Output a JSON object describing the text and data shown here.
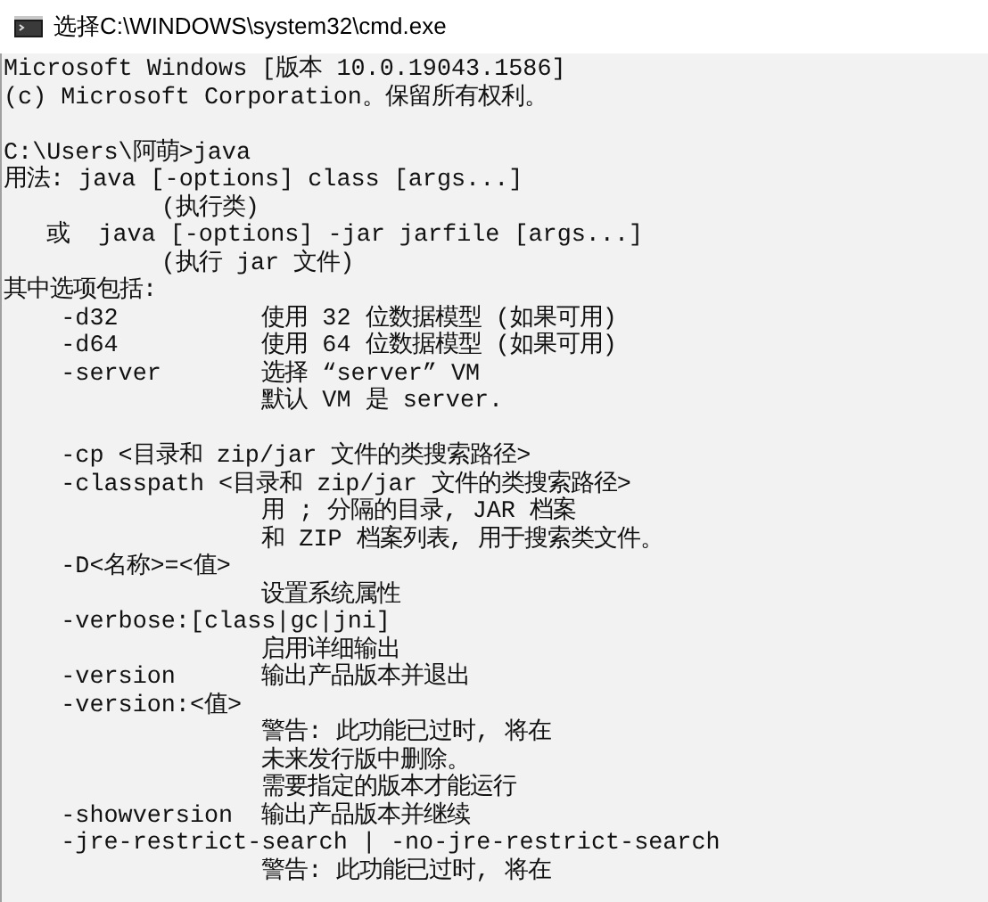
{
  "window": {
    "title": "选择C:\\WINDOWS\\system32\\cmd.exe"
  },
  "console": {
    "blocks": [
      [
        "Microsoft Windows [版本 10.0.19043.1586]",
        "(c) Microsoft Corporation。保留所有权利。"
      ],
      [
        "C:\\Users\\阿萌>java",
        "用法: java [-options] class [args...]",
        "           (执行类)",
        "   或  java [-options] -jar jarfile [args...]",
        "           (执行 jar 文件)",
        "其中选项包括:",
        "    -d32          使用 32 位数据模型 (如果可用)",
        "    -d64          使用 64 位数据模型 (如果可用)",
        "    -server       选择 “server” VM",
        "                  默认 VM 是 server."
      ],
      [
        "    -cp <目录和 zip/jar 文件的类搜索路径>",
        "    -classpath <目录和 zip/jar 文件的类搜索路径>",
        "                  用 ; 分隔的目录, JAR 档案",
        "                  和 ZIP 档案列表, 用于搜索类文件。",
        "    -D<名称>=<值>",
        "                  设置系统属性",
        "    -verbose:[class|gc|jni]",
        "                  启用详细输出",
        "    -version      输出产品版本并退出",
        "    -version:<值>",
        "                  警告: 此功能已过时, 将在",
        "                  未来发行版中删除。",
        "                  需要指定的版本才能运行",
        "    -showversion  输出产品版本并继续",
        "    -jre-restrict-search | -no-jre-restrict-search",
        "                  警告: 此功能已过时, 将在"
      ]
    ]
  }
}
